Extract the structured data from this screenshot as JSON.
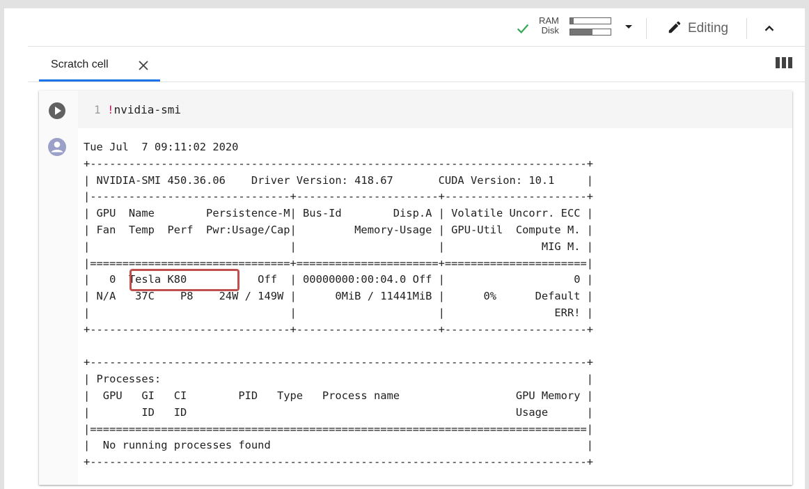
{
  "toolbar": {
    "ram_label": "RAM",
    "disk_label": "Disk",
    "ram_usage": 0.08,
    "disk_usage": 0.55,
    "editing_label": "Editing",
    "icons": [
      "check-icon",
      "dropdown-icon",
      "pencil-icon",
      "chevron-up-icon",
      "columns-icon"
    ]
  },
  "tab": {
    "label": "Scratch cell",
    "close_icon": "close-icon",
    "accent_color": "#1a73e8"
  },
  "cell": {
    "line_number": "1",
    "code_prefix": "!",
    "code_rest": "nvidia-smi",
    "output_lines": [
      "Tue Jul  7 09:11:02 2020",
      "+-----------------------------------------------------------------------------+",
      "| NVIDIA-SMI 450.36.06    Driver Version: 418.67       CUDA Version: 10.1     |",
      "|-------------------------------+----------------------+----------------------+",
      "| GPU  Name        Persistence-M| Bus-Id        Disp.A | Volatile Uncorr. ECC |",
      "| Fan  Temp  Perf  Pwr:Usage/Cap|         Memory-Usage | GPU-Util  Compute M. |",
      "|                               |                      |               MIG M. |",
      "|===============================+======================+======================|",
      "|   0  Tesla K80           Off  | 00000000:00:04.0 Off |                    0 |",
      "| N/A   37C    P8    24W / 149W |      0MiB / 11441MiB |      0%      Default |",
      "|                               |                      |                 ERR! |",
      "+-------------------------------+----------------------+----------------------+",
      "",
      "+-----------------------------------------------------------------------------+",
      "| Processes:                                                                  |",
      "|  GPU   GI   CI        PID   Type   Process name                  GPU Memory |",
      "|        ID   ID                                                   Usage      |",
      "|=============================================================================|",
      "|  No running processes found                                                 |",
      "+-----------------------------------------------------------------------------+"
    ],
    "highlight_color": "#c0504d"
  }
}
